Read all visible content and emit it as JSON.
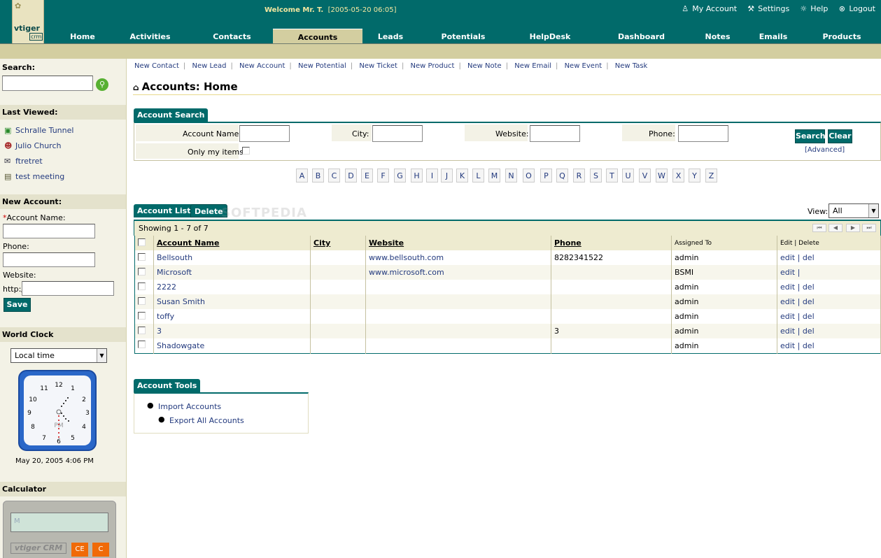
{
  "app": {
    "logo_top": "vtiger",
    "logo_bottom": "crm"
  },
  "header": {
    "welcome": "Welcome Mr. T.",
    "datetime": "[2005-05-20 06:05]",
    "links": [
      {
        "label": "My Account",
        "icon": "person-icon"
      },
      {
        "label": "Settings",
        "icon": "tools-icon"
      },
      {
        "label": "Help",
        "icon": "bulb-icon"
      },
      {
        "label": "Logout",
        "icon": "logout-icon"
      }
    ]
  },
  "tabs": [
    "Home",
    "Activities",
    "Contacts",
    "Accounts",
    "Leads",
    "Potentials",
    "HelpDesk",
    "Dashboard",
    "Notes",
    "Emails",
    "Products"
  ],
  "active_tab": "Accounts",
  "sidebar": {
    "search_label": "Search:",
    "last_viewed_label": "Last Viewed:",
    "last_viewed": [
      {
        "label": "Schralle Tunnel",
        "icon": "account-icon"
      },
      {
        "label": "Julio Church",
        "icon": "contact-icon"
      },
      {
        "label": "ftretret",
        "icon": "email-icon"
      },
      {
        "label": "test meeting",
        "icon": "calendar-icon"
      }
    ],
    "new_account_label": "New Account:",
    "account_name_label": "Account Name:",
    "required_mark": "*",
    "phone_label": "Phone:",
    "website_label": "Website:",
    "website_prefix": "http://",
    "save_label": "Save",
    "world_clock_label": "World Clock",
    "clock_select": "Local time",
    "clock_ampm": "PM",
    "clock_date": "May 20, 2005 4:06 PM",
    "calculator_label": "Calculator",
    "calc_display": "M",
    "calc_brand": "vtiger CRM",
    "calc_ce": "CE",
    "calc_c": "C"
  },
  "quicklinks": [
    "New Contact",
    "New Lead",
    "New Account",
    "New Potential",
    "New Ticket",
    "New Product",
    "New Note",
    "New Email",
    "New Event",
    "New Task"
  ],
  "page_title": "Accounts: Home",
  "search_panel": {
    "tab_label": "Account Search",
    "account_name_label": "Account Name:",
    "city_label": "City:",
    "website_label": "Website:",
    "phone_label": "Phone:",
    "only_my_items_label": "Only my items:",
    "search_button": "Search",
    "clear_button": "Clear",
    "advanced_link": "[Advanced]"
  },
  "letters": [
    "A",
    "B",
    "C",
    "D",
    "E",
    "F",
    "G",
    "H",
    "I",
    "J",
    "K",
    "L",
    "M",
    "N",
    "O",
    "P",
    "Q",
    "R",
    "S",
    "T",
    "U",
    "V",
    "W",
    "X",
    "Y",
    "Z"
  ],
  "list": {
    "tab_label": "Account List",
    "delete_label": "Delete",
    "watermark": "SOFTPEDIA",
    "view_label": "View:",
    "view_value": "All",
    "showing": "Showing 1 - 7 of 7",
    "columns": [
      "Account Name",
      "City",
      "Website",
      "Phone",
      "Assigned To",
      "Edit | Delete"
    ],
    "rows": [
      {
        "name": "Bellsouth",
        "city": "",
        "website": "www.bellsouth.com",
        "phone": "8282341522",
        "assigned": "admin",
        "actions": "edit | del"
      },
      {
        "name": "Microsoft",
        "city": "",
        "website": "www.microsoft.com",
        "phone": "",
        "assigned": "BSMI",
        "actions": "edit |"
      },
      {
        "name": "2222",
        "city": "",
        "website": "",
        "phone": "",
        "assigned": "admin",
        "actions": "edit | del"
      },
      {
        "name": "Susan Smith",
        "city": "",
        "website": "",
        "phone": "",
        "assigned": "admin",
        "actions": "edit | del"
      },
      {
        "name": "toffy",
        "city": "",
        "website": "",
        "phone": "",
        "assigned": "admin",
        "actions": "edit | del"
      },
      {
        "name": "3",
        "city": "",
        "website": "",
        "phone": "3",
        "assigned": "admin",
        "actions": "edit | del"
      },
      {
        "name": "Shadowgate",
        "city": "",
        "website": "",
        "phone": "",
        "assigned": "admin",
        "actions": "edit | del"
      }
    ]
  },
  "tools": {
    "tab_label": "Account Tools",
    "items": [
      "Import Accounts",
      "Export All Accounts"
    ]
  },
  "colors": {
    "primary": "#016a6a",
    "accent_bar": "#d3cea0",
    "link": "#233a7e"
  }
}
